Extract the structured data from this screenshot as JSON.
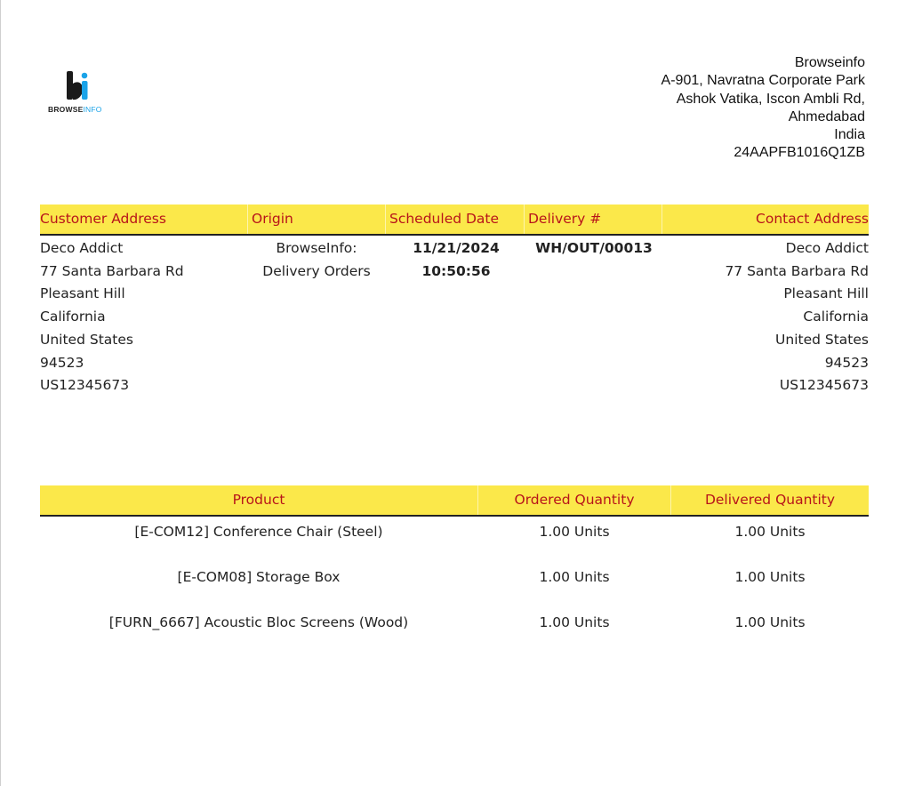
{
  "logo": {
    "text_main": "BROWSE",
    "text_accent": "INFO",
    "colors": {
      "dark": "#1a1a1a",
      "accent": "#1aa3e8"
    }
  },
  "company": {
    "lines": [
      "Browseinfo",
      "A-901, Navratna Corporate Park",
      "Ashok Vatika, Iscon Ambli Rd,",
      "Ahmedabad",
      "India",
      "24AAPFB1016Q1ZB"
    ]
  },
  "info_table": {
    "headers": {
      "customer_address": "Customer Address",
      "origin": "Origin",
      "scheduled_date": "Scheduled Date",
      "delivery_no": "Delivery #",
      "contact_address": "Contact Address"
    },
    "customer_address": [
      "Deco Addict",
      "77 Santa Barbara Rd",
      "Pleasant Hill",
      "California",
      "United States",
      "94523",
      "US12345673"
    ],
    "origin": [
      "BrowseInfo:",
      "Delivery Orders"
    ],
    "scheduled_date": [
      "11/21/2024",
      "10:50:56"
    ],
    "delivery_no": "WH/OUT/00013",
    "contact_address": [
      "Deco Addict",
      "77 Santa Barbara Rd",
      "Pleasant Hill",
      "California",
      "United States",
      "94523",
      "US12345673"
    ]
  },
  "product_table": {
    "headers": {
      "product": "Product",
      "ordered": "Ordered Quantity",
      "delivered": "Delivered Quantity"
    },
    "rows": [
      {
        "product": "[E-COM12] Conference Chair (Steel)",
        "ordered": "1.00 Units",
        "delivered": "1.00 Units"
      },
      {
        "product": "[E-COM08] Storage Box",
        "ordered": "1.00 Units",
        "delivered": "1.00 Units"
      },
      {
        "product": "[FURN_6667] Acoustic Bloc Screens (Wood)",
        "ordered": "1.00 Units",
        "delivered": "1.00 Units"
      }
    ]
  },
  "colors": {
    "header_bg": "#fbe84a",
    "header_text": "#b8141a"
  }
}
